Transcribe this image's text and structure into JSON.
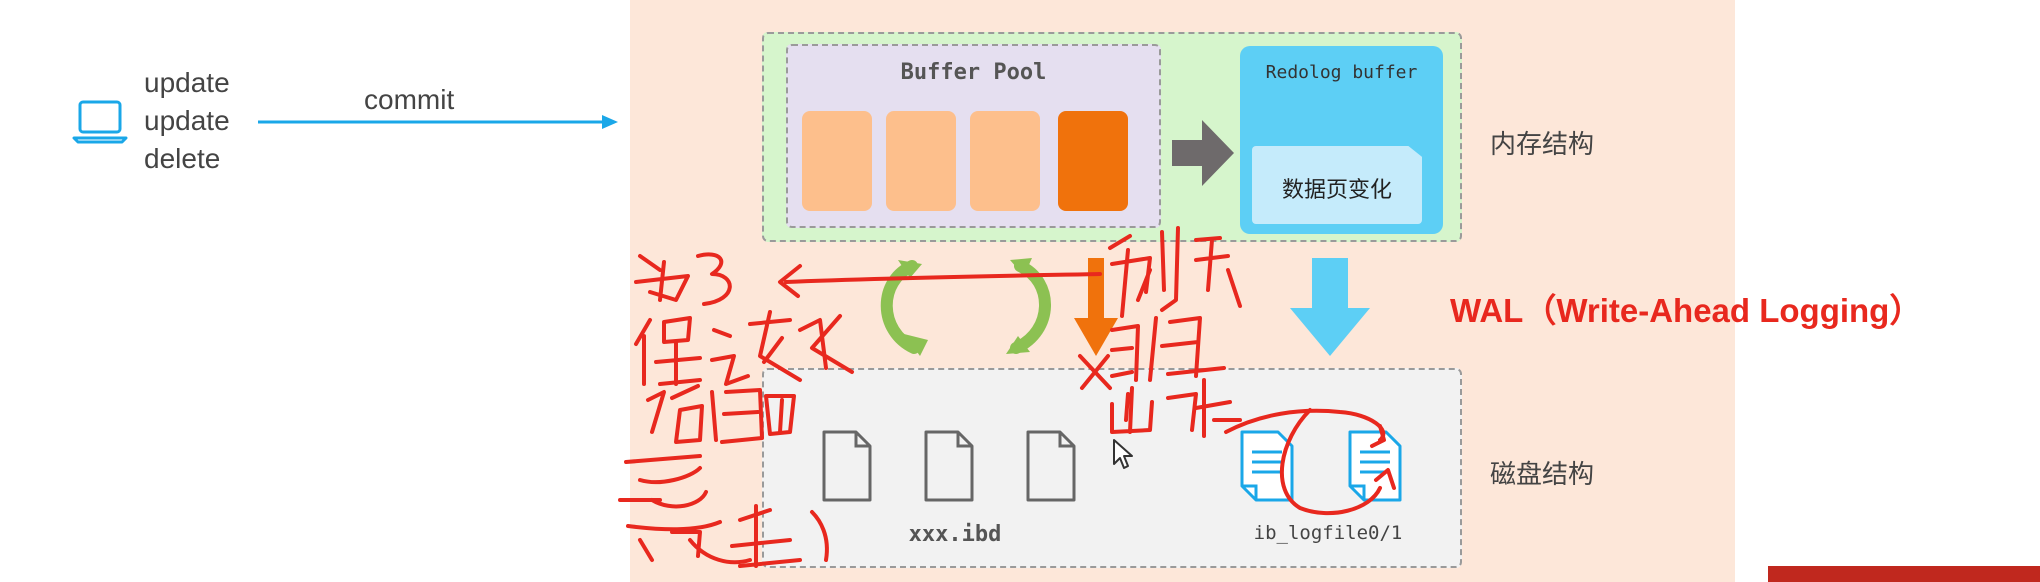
{
  "left": {
    "operations": [
      "update",
      "update",
      "delete"
    ],
    "arrow_label": "commit",
    "icon": "laptop-icon"
  },
  "memory": {
    "buffer_pool_title": "Buffer Pool",
    "redolog_title": "Redolog buffer",
    "redolog_inner_label": "数据页变化",
    "side_label": "内存结构",
    "page_colors": [
      "#fdbf8c",
      "#fdbf8c",
      "#fdbf8c",
      "#f0720c"
    ]
  },
  "disk": {
    "ibd_label": "xxx.ibd",
    "logfile_label": "ib_logfile0/1",
    "side_label": "磁盘结构"
  },
  "wal_label": "WAL（Write-Ahead Logging）",
  "colors": {
    "panel_bg": "#fde7d9",
    "memory_bg": "#d6f5cc",
    "buffer_pool_bg": "#e5dff0",
    "redolog_bg": "#5dcff5",
    "disk_bg": "#f2f2f2",
    "accent_blue": "#1aa7e8",
    "accent_orange": "#f0720c",
    "cycle_green": "#8cc152",
    "annotation_red": "#e8281e"
  }
}
